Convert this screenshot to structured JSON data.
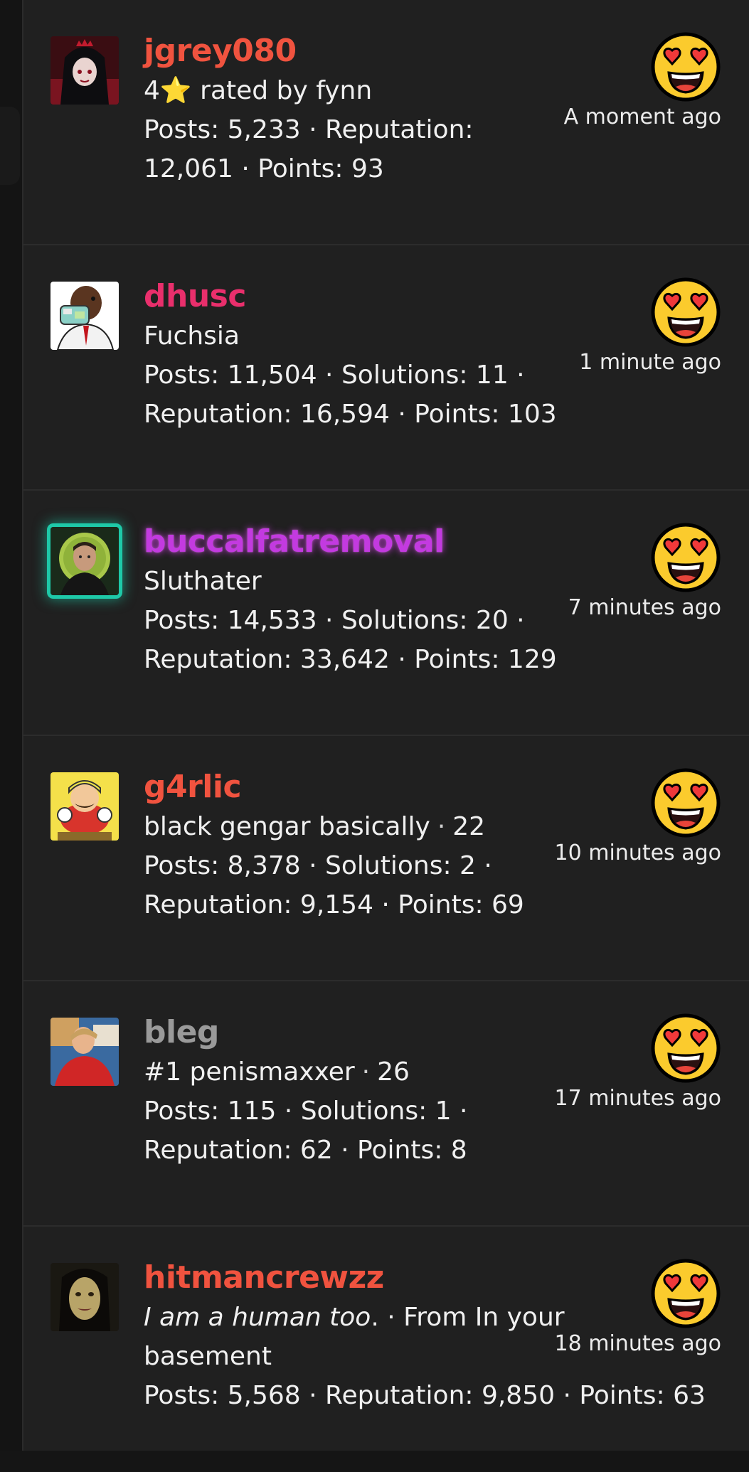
{
  "colors": {
    "background": "#202020",
    "name_red": "#f0533f",
    "name_pink": "#e92f6c",
    "name_magenta": "#c33ae0",
    "name_gray": "#9a9a9a",
    "text": "#f0f0f0",
    "emoji_yellow": "#fbcb2d",
    "heart_red": "#f0393a",
    "frame_teal": "#1ec9a8"
  },
  "reaction_icon": "heart-eyes-emoji",
  "items": [
    {
      "username": "jgrey080",
      "rating_prefix": "4",
      "rating_star": "⭐",
      "rating_suffix": " rated by fynn",
      "stats_line1": "Posts: 5,233 · Reputation:",
      "stats_line2": "12,061 · Points: 93",
      "time": "A moment ago"
    },
    {
      "username": "dhusc",
      "subtitle": "Fuchsia",
      "stats_line1": "Posts: 11,504 · Solutions: 11 ·",
      "stats_line2": "Reputation: 16,594 · Points: 103",
      "time": "1 minute ago"
    },
    {
      "username": "buccalfatremoval",
      "subtitle": "Sluthater",
      "stats_line1": "Posts: 14,533 · Solutions: 20 ·",
      "stats_line2": "Reputation: 33,642 · Points: 129",
      "time": "7 minutes ago"
    },
    {
      "username": "g4rlic",
      "subtitle": "black gengar basically",
      "subtitle_extra": "22",
      "stats_line1": "Posts: 8,378 · Solutions: 2 ·",
      "stats_line2": "Reputation: 9,154 · Points: 69",
      "time": "10 minutes ago"
    },
    {
      "username": "bleg",
      "subtitle": "#1 penismaxxer",
      "subtitle_extra": "26",
      "stats_line1": "Posts: 115 · Solutions: 1 ·",
      "stats_line2": "Reputation: 62 · Points: 8",
      "time": "17 minutes ago"
    },
    {
      "username": "hitmancrewzz",
      "subtitle_italic": "I am a human too",
      "subtitle_after": ". · From In your",
      "subtitle_line2": "basement",
      "stats_line1": "Posts: 5,568 · Reputation: 9,850 · Points: 63",
      "time": "18 minutes ago"
    }
  ]
}
